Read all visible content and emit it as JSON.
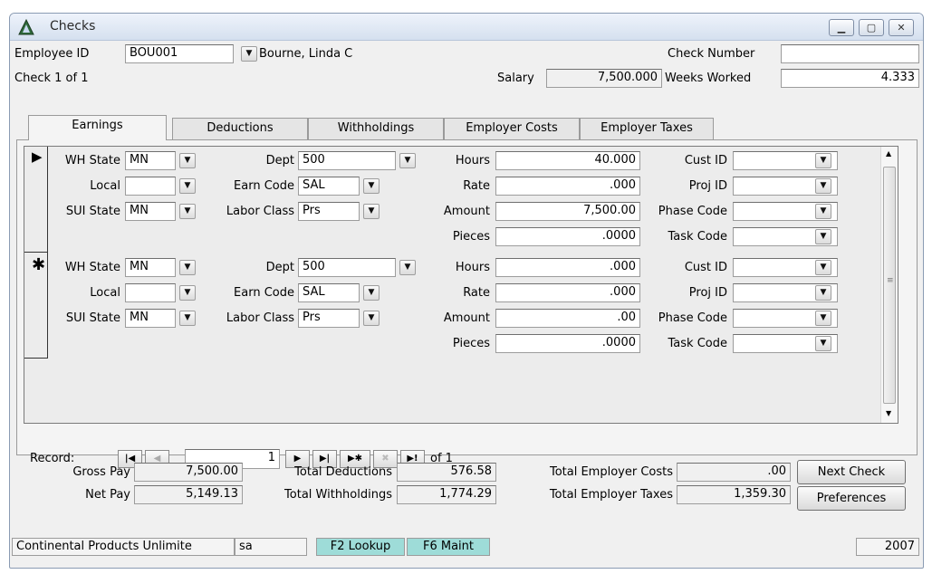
{
  "window": {
    "title": "Checks"
  },
  "header": {
    "employee_id_label": "Employee ID",
    "employee_id_value": "BOU001",
    "employee_name": "Bourne, Linda C",
    "check_number_label": "Check Number",
    "check_number_value": "",
    "check_of": "Check 1 of 1",
    "salary_label": "Salary",
    "salary_value": "7,500.000",
    "weeks_worked_label": "Weeks Worked",
    "weeks_worked_value": "4.333"
  },
  "tabs": [
    {
      "label": "Earnings",
      "active": true
    },
    {
      "label": "Deductions"
    },
    {
      "label": "Withholdings"
    },
    {
      "label": "Employer Costs"
    },
    {
      "label": "Employer Taxes"
    }
  ],
  "labels": {
    "wh_state": "WH State",
    "local": "Local",
    "sui_state": "SUI State",
    "dept": "Dept",
    "earn_code": "Earn Code",
    "labor_class": "Labor Class",
    "hours": "Hours",
    "rate": "Rate",
    "amount": "Amount",
    "pieces": "Pieces",
    "cust_id": "Cust ID",
    "proj_id": "Proj ID",
    "phase_code": "Phase Code",
    "task_code": "Task Code"
  },
  "rows": [
    {
      "selector": "current",
      "wh_state": "MN",
      "local": "",
      "sui_state": "MN",
      "dept": "500",
      "earn_code": "SAL",
      "labor_class": "Prs",
      "hours": "40.000",
      "rate": ".000",
      "amount": "7,500.00",
      "pieces": ".0000",
      "cust_id": "",
      "proj_id": "",
      "phase_code": "",
      "task_code": ""
    },
    {
      "selector": "new",
      "wh_state": "MN",
      "local": "",
      "sui_state": "MN",
      "dept": "500",
      "earn_code": "SAL",
      "labor_class": "Prs",
      "hours": ".000",
      "rate": ".000",
      "amount": ".00",
      "pieces": ".0000",
      "cust_id": "",
      "proj_id": "",
      "phase_code": "",
      "task_code": ""
    }
  ],
  "record_nav": {
    "label": "Record:",
    "current": "1",
    "of_text": "of 1"
  },
  "totals": {
    "gross_pay_label": "Gross Pay",
    "gross_pay": "7,500.00",
    "net_pay_label": "Net Pay",
    "net_pay": "5,149.13",
    "total_deductions_label": "Total Deductions",
    "total_deductions": "576.58",
    "total_withholdings_label": "Total Withholdings",
    "total_withholdings": "1,774.29",
    "total_employer_costs_label": "Total Employer Costs",
    "total_employer_costs": ".00",
    "total_employer_taxes_label": "Total Employer Taxes",
    "total_employer_taxes": "1,359.30"
  },
  "buttons": {
    "next_check": "Next Check",
    "preferences": "Preferences"
  },
  "status": {
    "company": "Continental Products Unlimite",
    "user": "sa",
    "f2": "F2  Lookup",
    "f6": "F6  Maint",
    "year": "2007"
  },
  "colors": {
    "status_key_bg": "#9edcd8"
  }
}
